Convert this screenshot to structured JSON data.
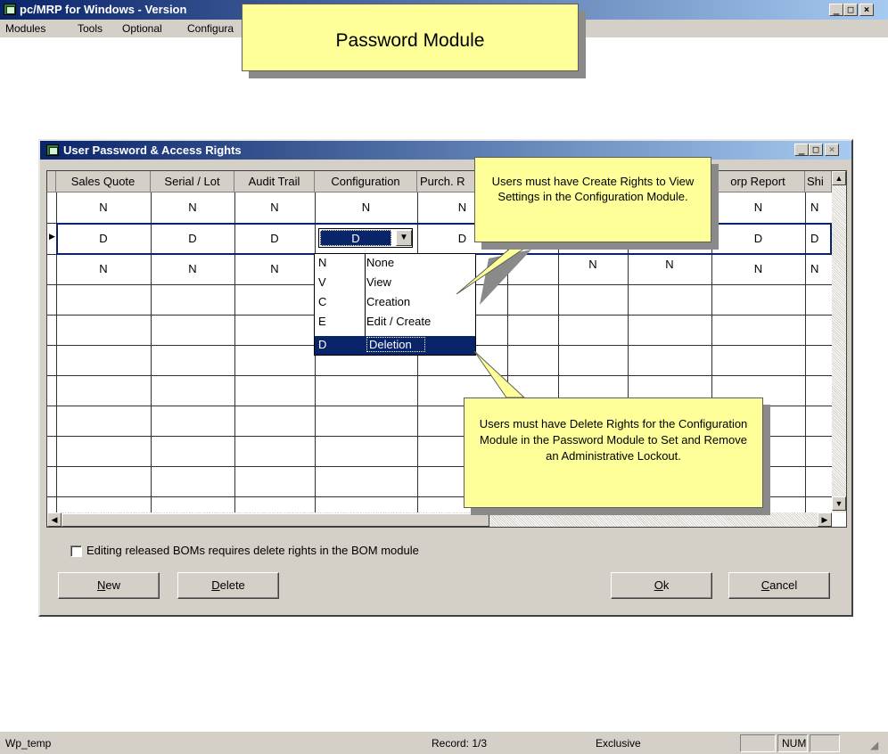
{
  "window": {
    "title": "pc/MRP for Windows - Version",
    "menu": [
      "Modules",
      "Tools",
      "Optional",
      "Configura"
    ]
  },
  "top_callout": {
    "text": "Password Module"
  },
  "dialog": {
    "title": "User Password & Access Rights",
    "columns": [
      "Sales Quote",
      "Serial / Lot",
      "Audit Trail",
      "Configuration",
      "Purch. R",
      "orp Report",
      "Shi"
    ],
    "rows": [
      {
        "values": [
          "N",
          "N",
          "N",
          "N",
          "N",
          "N",
          "N"
        ],
        "current": false
      },
      {
        "values": [
          "D",
          "D",
          "D",
          "D",
          "D",
          "D",
          "D"
        ],
        "current": true
      },
      {
        "values": [
          "N",
          "N",
          "N",
          "N",
          "N",
          "N",
          "N"
        ],
        "current": false
      }
    ],
    "hidden_partial_row3": [
      "N",
      "N"
    ],
    "configuration_dropdown": {
      "selected": "D",
      "options": [
        {
          "code": "N",
          "label": "None"
        },
        {
          "code": "V",
          "label": "View"
        },
        {
          "code": "C",
          "label": "Creation"
        },
        {
          "code": "E",
          "label": "Edit / Create"
        },
        {
          "code": "D",
          "label": "Deletion"
        }
      ],
      "highlighted_option": 4
    },
    "checkbox_label": "Editing released BOMs requires delete rights in the BOM module",
    "checkbox_checked": false,
    "buttons": {
      "new": "New",
      "delete": "Delete",
      "ok": "Ok",
      "cancel": "Cancel"
    },
    "button_mnemonics": {
      "new": "N",
      "delete": "D",
      "ok": "O",
      "cancel": "C"
    }
  },
  "callouts": {
    "create_rights": "Users must have Create Rights to View Settings in the Configuration Module.",
    "delete_rights": "Users must have Delete Rights for the Configuration Module in the Password Module to Set and Remove an Administrative Lockout."
  },
  "statusbar": {
    "left": "Wp_temp",
    "record": "Record: 1/3",
    "mode": "Exclusive",
    "num": "NUM"
  },
  "colors": {
    "titlebar_start": "#0a246a",
    "titlebar_end": "#a6caf0",
    "callout_fill": "#ffff99",
    "selection": "#0a246a",
    "face": "#d4d0c8"
  }
}
